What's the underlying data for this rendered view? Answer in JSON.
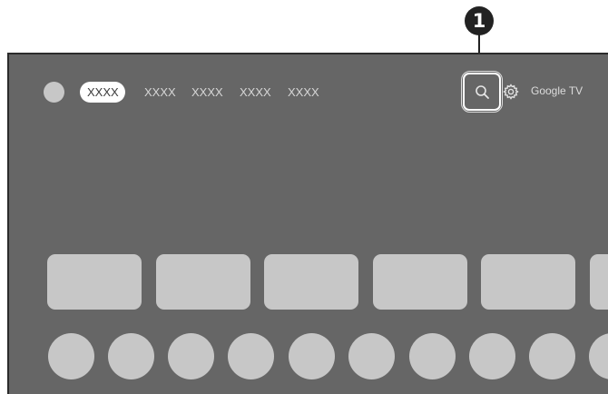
{
  "callout": {
    "number": "1"
  },
  "nav": {
    "tabs": [
      {
        "label": "XXXX",
        "active": true
      },
      {
        "label": "XXXX",
        "active": false
      },
      {
        "label": "XXXX",
        "active": false
      },
      {
        "label": "XXXX",
        "active": false
      },
      {
        "label": "XXXX",
        "active": false
      }
    ],
    "brand": "Google TV",
    "icons": [
      "profile-avatar",
      "search-icon",
      "gear-icon"
    ]
  },
  "colors": {
    "screen_background": "#666666",
    "tile": "#c7c7c7",
    "active_tab": "#ffffff",
    "callout": "#222222"
  }
}
